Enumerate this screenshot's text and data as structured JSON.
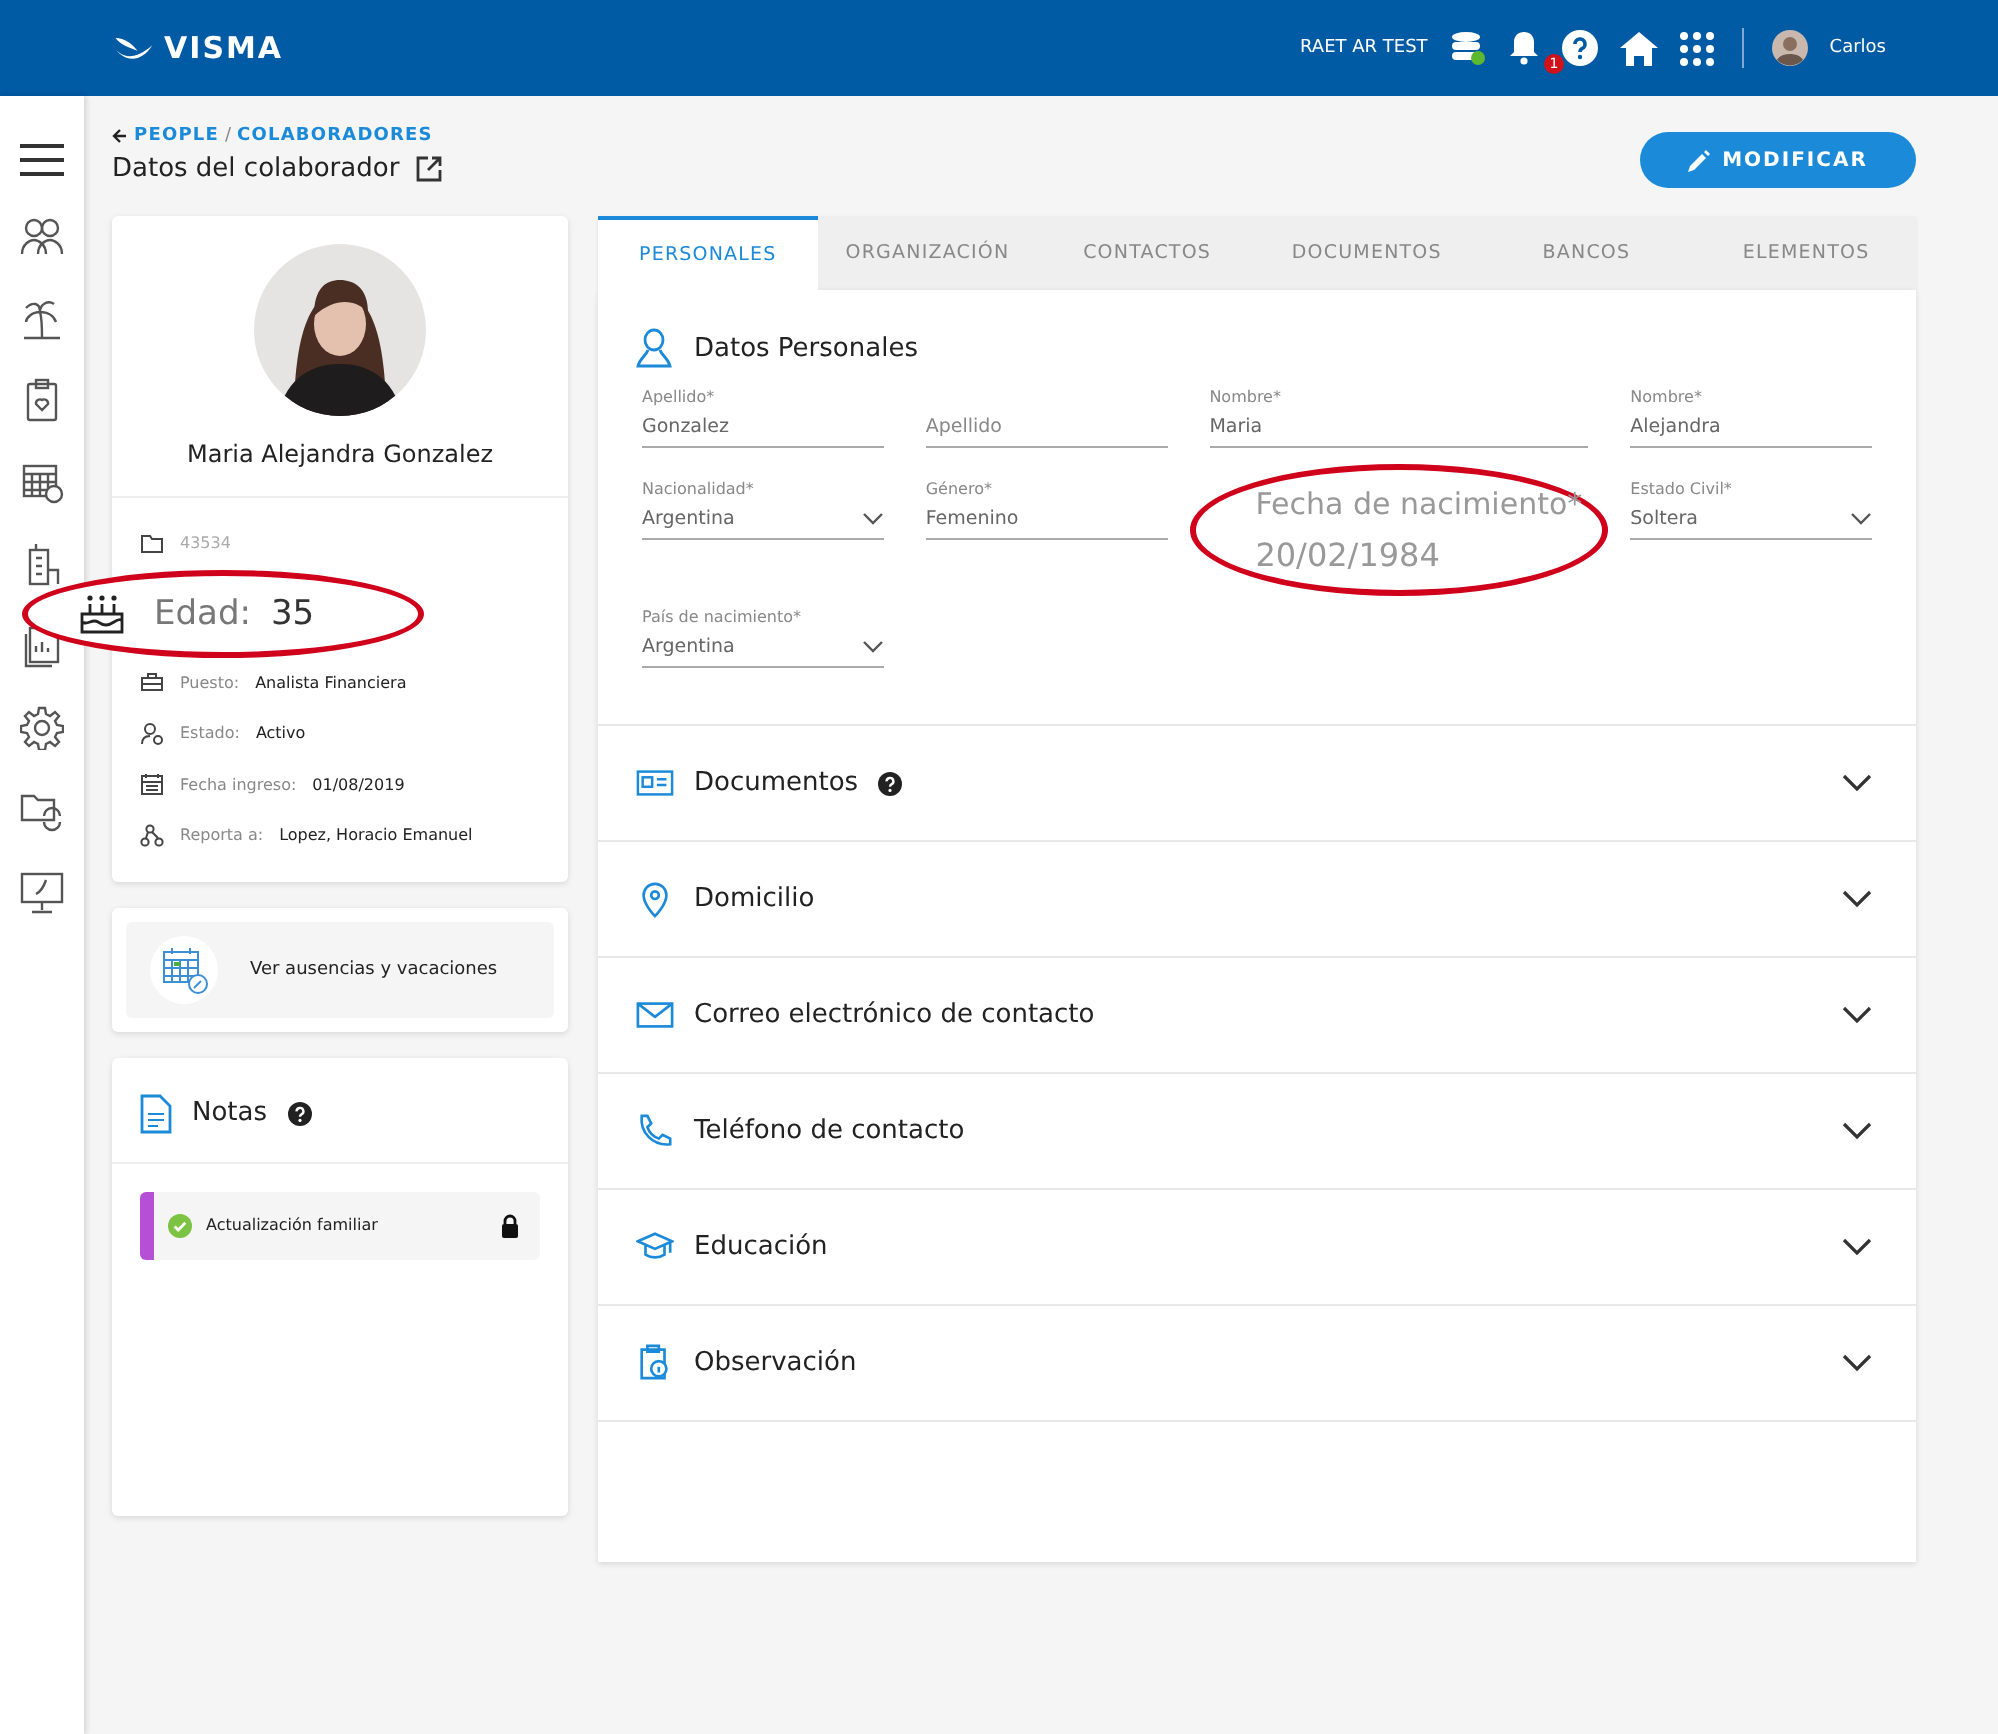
{
  "header": {
    "brand": "VISMA",
    "environment": "RAET AR TEST",
    "notification_count": "1",
    "user": "Carlos"
  },
  "breadcrumb": [
    "PEOPLE",
    "COLABORADORES"
  ],
  "breadcrumb_separator": "/",
  "page_title": "Datos del colaborador",
  "edit_button": "MODIFICAR",
  "profile": {
    "name": "Maria Alejandra Gonzalez",
    "info": [
      {
        "kind": "id",
        "value": "43534"
      },
      {
        "kind": "age",
        "label": "Edad:",
        "value": "35"
      },
      {
        "kind": "job",
        "label": "Puesto:",
        "value": "Analista Financiera"
      },
      {
        "kind": "status",
        "label": "Estado:",
        "value": "Activo"
      },
      {
        "kind": "date",
        "label": "Fecha ingreso:",
        "value": "01/08/2019"
      },
      {
        "kind": "boss",
        "label": "Reporta a:",
        "value": "Lopez, Horacio Emanuel"
      }
    ]
  },
  "absences_link": "Ver ausencias y vacaciones",
  "notes": {
    "title": "Notas",
    "items": [
      {
        "text": "Actualización familiar",
        "color": "#b44fd6",
        "locked": true
      }
    ]
  },
  "tabs": [
    {
      "label": "PERSONALES",
      "selected": true
    },
    {
      "label": "ORGANIZACIÓN",
      "selected": false
    },
    {
      "label": "CONTACTOS",
      "selected": false
    },
    {
      "label": "DOCUMENTOS",
      "selected": false
    },
    {
      "label": "BANCOS",
      "selected": false
    },
    {
      "label": "ELEMENTOS",
      "selected": false
    }
  ],
  "personal": {
    "title": "Datos Personales",
    "fields": [
      {
        "kind": "text",
        "label": "Apellido*",
        "value": "Gonzalez"
      },
      {
        "kind": "text",
        "placeholder": "Apellido"
      },
      {
        "kind": "text",
        "label": "Nombre*",
        "value": "Maria"
      },
      {
        "kind": "text",
        "label": "Nombre*",
        "value": "Alejandra"
      },
      {
        "kind": "select",
        "label": "Nacionalidad*",
        "value": "Argentina"
      },
      {
        "kind": "text",
        "label": "Género*",
        "value": "Femenino"
      },
      {
        "kind": "highlight",
        "label": "Fecha de nacimiento*",
        "value": "20/02/1984"
      },
      {
        "kind": "select",
        "label": "Estado Civil*",
        "value": "Soltera"
      },
      {
        "kind": "select",
        "label": "País de nacimiento*",
        "value": "Argentina"
      }
    ]
  },
  "sections": [
    {
      "kind": "document",
      "title": "Documentos",
      "help": true
    },
    {
      "kind": "pin",
      "title": "Domicilio",
      "help": false
    },
    {
      "kind": "mail",
      "title": "Correo electrónico de contacto",
      "help": false
    },
    {
      "kind": "phone",
      "title": "Teléfono de contacto",
      "help": false
    },
    {
      "kind": "education",
      "title": "Educación",
      "help": false
    },
    {
      "kind": "note",
      "title": "Observación",
      "help": false
    }
  ]
}
